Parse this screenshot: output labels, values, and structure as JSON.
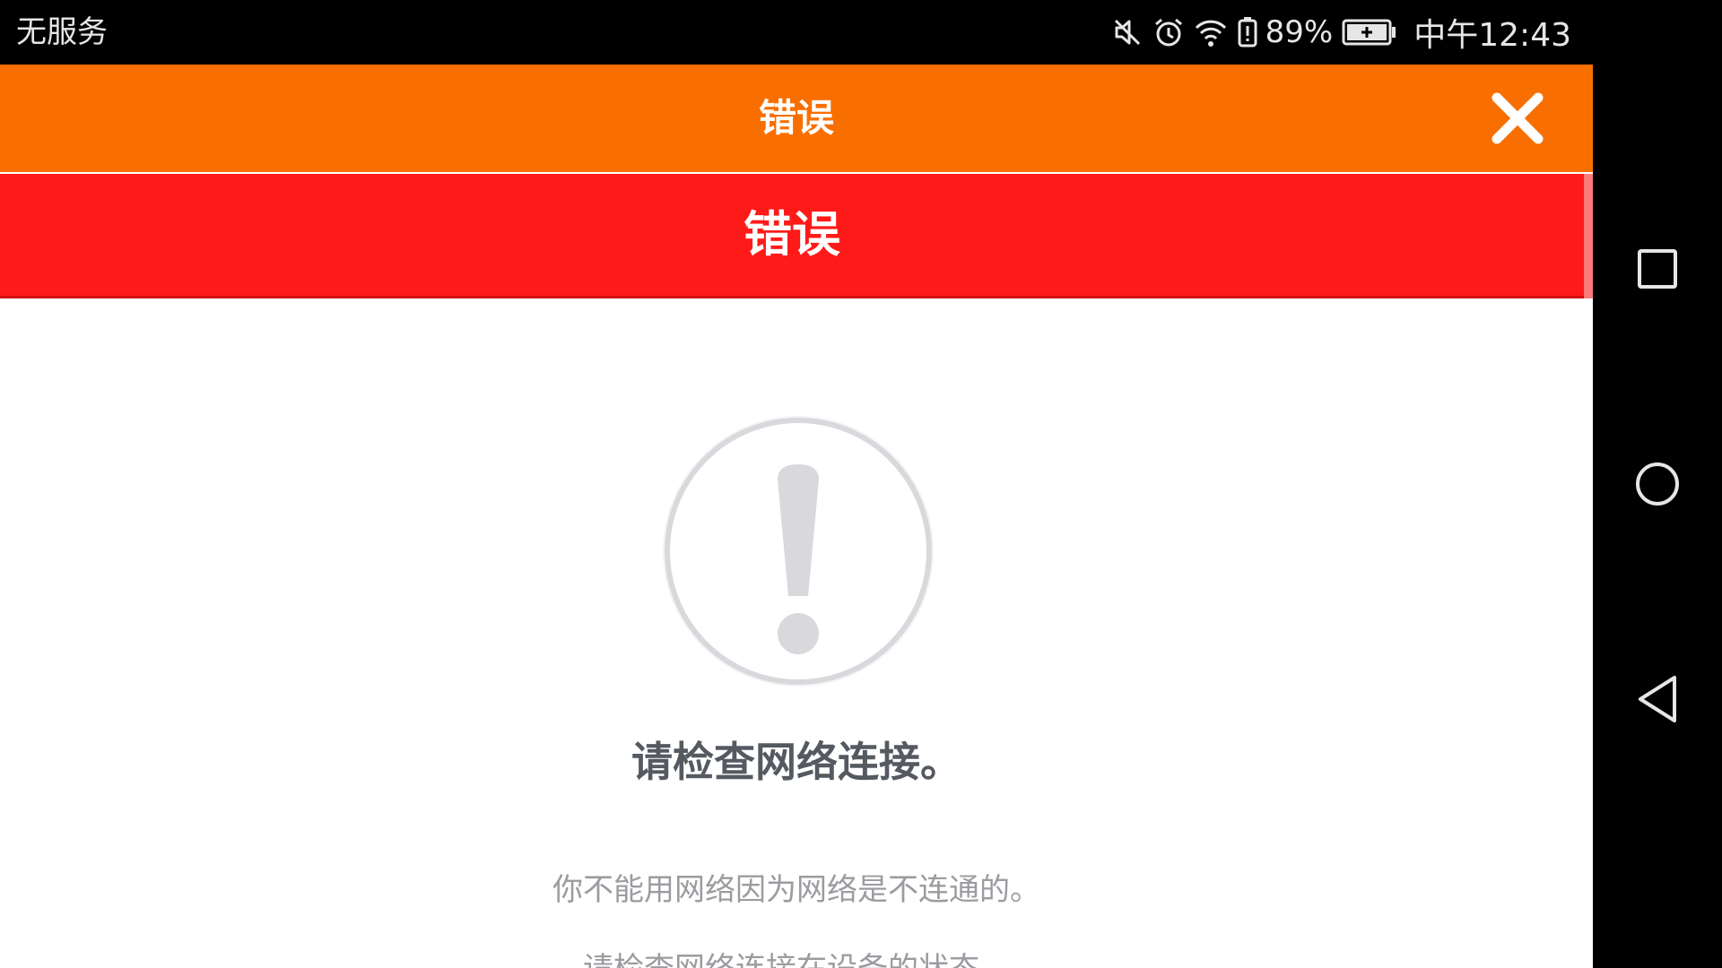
{
  "status_bar": {
    "carrier": "无服务",
    "battery_percent": "89%",
    "time": "中午12:43",
    "icons": [
      "mute-icon",
      "alarm-icon",
      "wifi-icon",
      "battery-saver-icon",
      "battery-charging-icon"
    ]
  },
  "header": {
    "title": "错误",
    "close_icon": "close-icon"
  },
  "banner": {
    "text": "错误"
  },
  "message": {
    "icon": "exclamation-circle-icon",
    "title": "请检查网络连接。",
    "line1": "你不能用网络因为网络是不连通的。",
    "line2": "请检查网络连接在设备的状态。"
  },
  "nav_bar": {
    "buttons": [
      "recents-icon",
      "home-icon",
      "back-icon"
    ]
  },
  "colors": {
    "header": "#f86f00",
    "banner": "#ff1a1a",
    "title_text": "#555a61",
    "body_text": "#9a9ca0",
    "icon_gray": "#d9d9dd"
  }
}
